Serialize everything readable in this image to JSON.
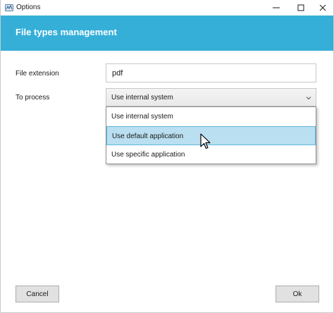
{
  "window": {
    "title": "Options",
    "controls": [
      "minimize-icon",
      "maximize-icon",
      "close-icon"
    ]
  },
  "header": {
    "title": "File types management",
    "background_color": "#35afd8"
  },
  "form": {
    "extension_label": "File extension",
    "extension_value": "pdf",
    "process_label": "To process",
    "process_selected": "Use internal system"
  },
  "dropdown": {
    "options": [
      "Use internal system",
      "Use default application",
      "Use specific application"
    ],
    "highlighted_index": 1,
    "highlight_color": "#b9dff1"
  },
  "buttons": {
    "cancel": "Cancel",
    "ok": "Ok"
  }
}
